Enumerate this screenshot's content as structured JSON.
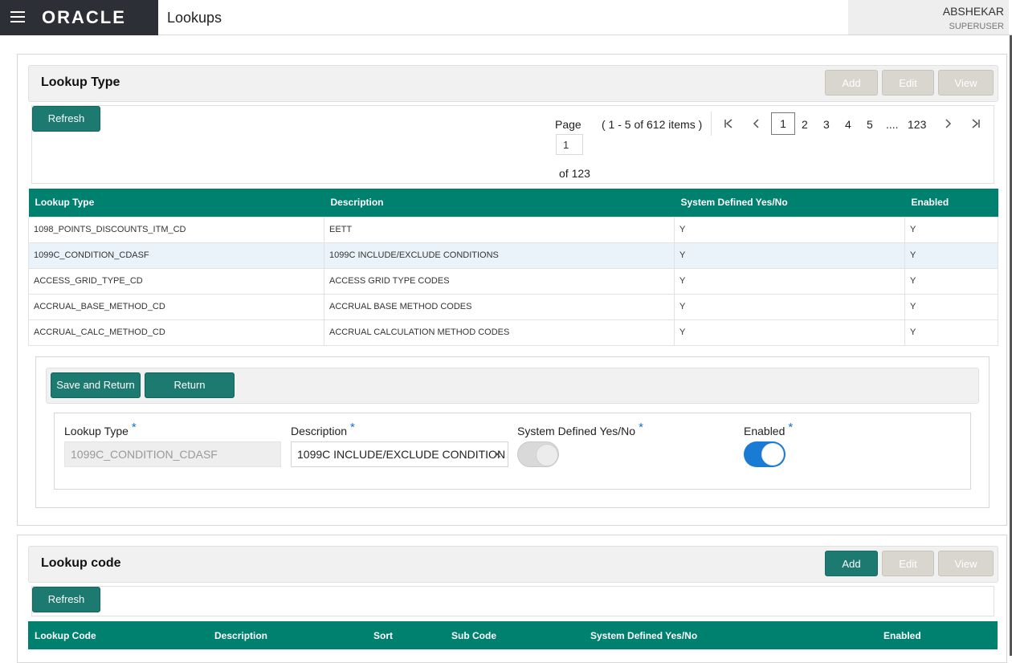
{
  "header": {
    "logo": "ORACLE",
    "title": "Lookups",
    "user_name": "ABSHEKAR",
    "user_role": "SUPERUSER"
  },
  "lookup_type": {
    "title": "Lookup Type",
    "add_label": "Add",
    "edit_label": "Edit",
    "view_label": "View",
    "refresh_label": "Refresh",
    "pagination": {
      "page_label": "Page",
      "page_value": "1",
      "of_label": "of 123",
      "items_text": "( 1 - 5 of 612 items )",
      "pages": [
        "1",
        "2",
        "3",
        "4",
        "5",
        "....",
        "123"
      ],
      "current": "1"
    },
    "columns": [
      "Lookup Type",
      "Description",
      "System Defined Yes/No",
      "Enabled"
    ],
    "rows": [
      [
        "1098_POINTS_DISCOUNTS_ITM_CD",
        "EETT",
        "Y",
        "Y"
      ],
      [
        "1099C_CONDITION_CDASF",
        "1099C INCLUDE/EXCLUDE CONDITIONS",
        "Y",
        "Y"
      ],
      [
        "ACCESS_GRID_TYPE_CD",
        "ACCESS GRID TYPE CODES",
        "Y",
        "Y"
      ],
      [
        "ACCRUAL_BASE_METHOD_CD",
        "ACCRUAL BASE METHOD CODES",
        "Y",
        "Y"
      ],
      [
        "ACCRUAL_CALC_METHOD_CD",
        "ACCRUAL CALCULATION METHOD CODES",
        "Y",
        "Y"
      ]
    ],
    "selected_row": 1
  },
  "edit_form": {
    "save_return_label": "Save and Return",
    "return_label": "Return",
    "lookup_type_label": "Lookup Type",
    "lookup_type_value": "1099C_CONDITION_CDASF",
    "description_label": "Description",
    "description_value": "1099C INCLUDE/EXCLUDE CONDITION",
    "system_defined_label": "System Defined Yes/No",
    "system_defined_on": false,
    "enabled_label": "Enabled",
    "enabled_on": true,
    "required_mark": "*"
  },
  "lookup_code": {
    "title": "Lookup code",
    "add_label": "Add",
    "edit_label": "Edit",
    "view_label": "View",
    "refresh_label": "Refresh",
    "columns": [
      "Lookup Code",
      "Description",
      "Sort",
      "Sub Code",
      "System Defined Yes/No",
      "Enabled"
    ]
  },
  "colors": {
    "accent": "#00806e",
    "button_teal": "#1d7a70",
    "toggle_on": "#1a7bd4",
    "brand_bg": "#2c2f36"
  }
}
